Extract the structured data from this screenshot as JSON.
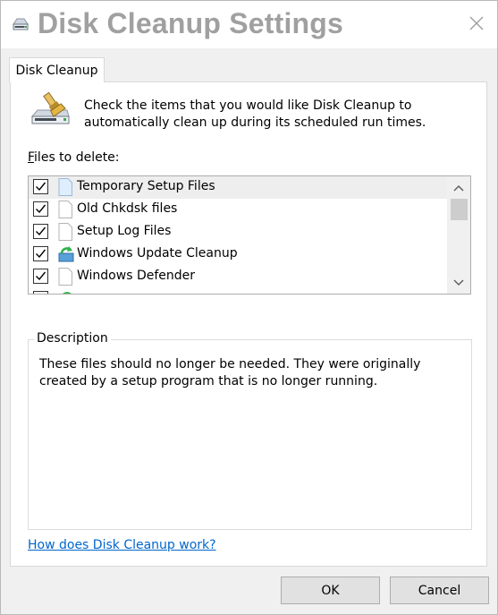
{
  "window": {
    "title": "Disk Cleanup Settings",
    "close_icon": "close-icon"
  },
  "tab": {
    "label": "Disk Cleanup"
  },
  "intro": {
    "text": "Check the items that you would like Disk Cleanup to automatically clean up during its scheduled run times.",
    "icon": "disk-cleanup-icon"
  },
  "files": {
    "label_accel": "F",
    "label_rest": "iles to delete:",
    "items": [
      {
        "label": "Temporary Setup Files",
        "checked": true,
        "icon": "blank-file-icon",
        "selected": true
      },
      {
        "label": "Old Chkdsk files",
        "checked": true,
        "icon": "blank-file-icon",
        "selected": false
      },
      {
        "label": "Setup Log Files",
        "checked": true,
        "icon": "blank-file-icon",
        "selected": false
      },
      {
        "label": "Windows Update Cleanup",
        "checked": true,
        "icon": "windows-update-icon",
        "selected": false
      },
      {
        "label": "Windows Defender",
        "checked": true,
        "icon": "blank-file-icon",
        "selected": false
      }
    ]
  },
  "description": {
    "legend": "Description",
    "text": "These files should no longer be needed. They were originally created by a setup program that is no longer running."
  },
  "help_link": "How does Disk Cleanup work?",
  "buttons": {
    "ok": "OK",
    "cancel": "Cancel"
  },
  "colors": {
    "link": "#0066cc",
    "title": "#a0a0a0",
    "selected_row": "#eeeeee"
  }
}
